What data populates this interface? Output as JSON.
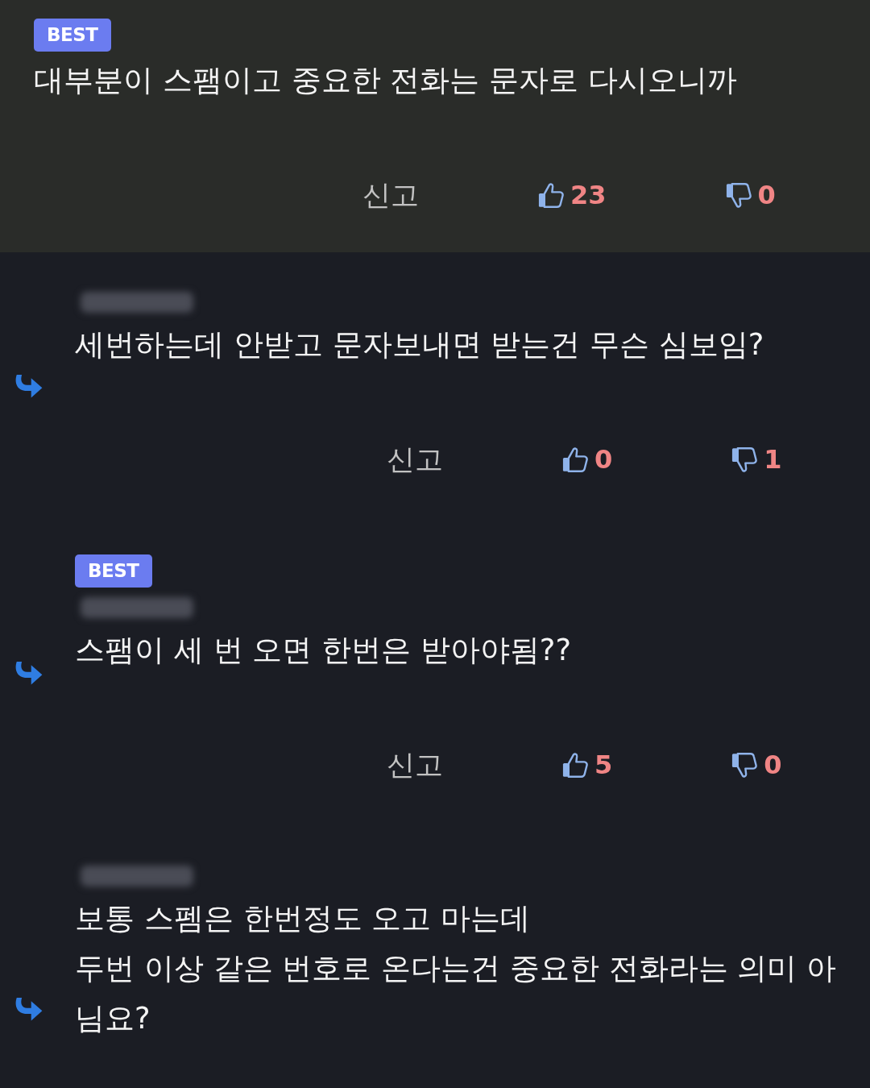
{
  "comments": [
    {
      "kind": "comment",
      "badge": "BEST",
      "name_blurred": false,
      "lines": [
        "대부분이 스팸이고 중요한 전화는 문자로 다시오니까"
      ],
      "actions": {
        "report": "신고",
        "likes": "23",
        "dislikes": "0"
      }
    },
    {
      "kind": "reply",
      "name_blurred": true,
      "lines": [
        "세번하는데 안받고 문자보내면 받는건 무슨 심보임?"
      ],
      "actions": {
        "report": "신고",
        "likes": "0",
        "dislikes": "1"
      }
    },
    {
      "kind": "reply",
      "badge": "BEST",
      "name_blurred": true,
      "lines": [
        "스팸이 세 번 오면 한번은 받아야됨??"
      ],
      "actions": {
        "report": "신고",
        "likes": "5",
        "dislikes": "0"
      }
    },
    {
      "kind": "reply",
      "name_blurred": true,
      "lines": [
        "보통 스펨은 한번정도 오고 마는데",
        "두번 이상 같은 번호로 온다는건 중요한 전화라는 의미 아",
        "님요?"
      ]
    }
  ]
}
